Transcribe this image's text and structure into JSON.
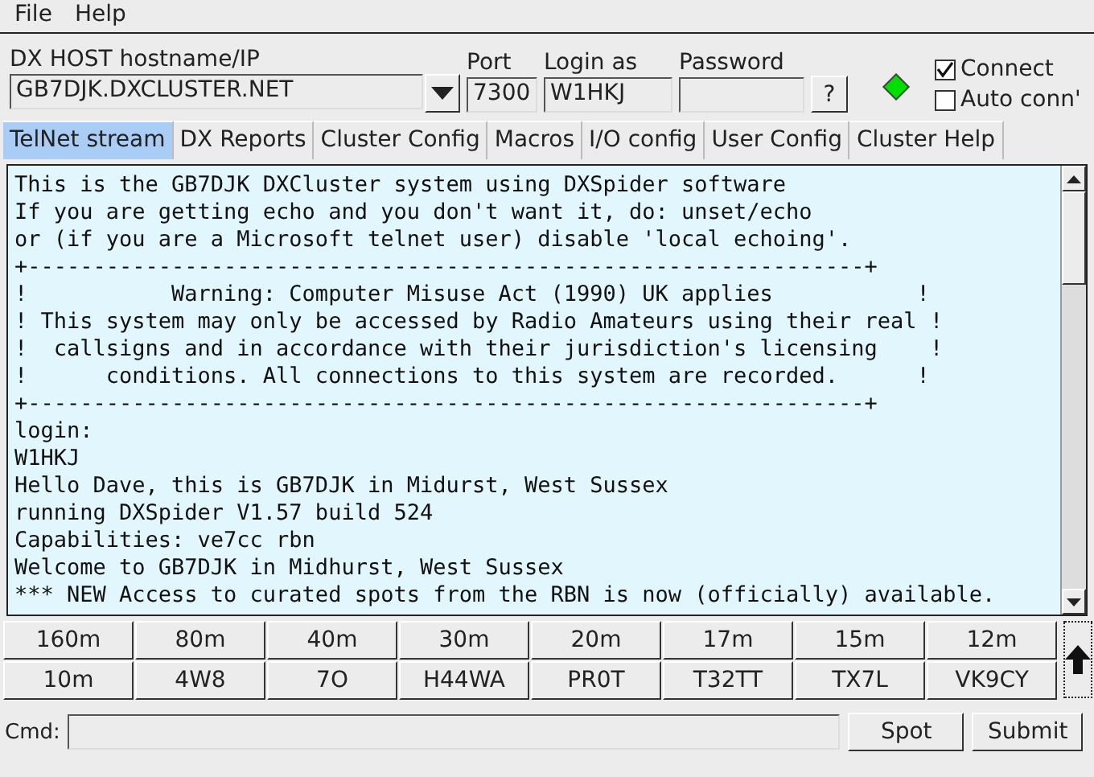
{
  "menu": [
    {
      "label": "File"
    },
    {
      "label": "Help"
    }
  ],
  "connection": {
    "host_label": "DX HOST hostname/IP",
    "host": "GB7DJK.DXCLUSTER.NET",
    "port_label": "Port",
    "port": "7300",
    "login_label": "Login as",
    "login": "W1HKJ",
    "password_label": "Password",
    "help_button": "?",
    "status_connected": true,
    "options": [
      {
        "label": "Connect",
        "checked": true
      },
      {
        "label": "Auto conn'",
        "checked": false
      }
    ]
  },
  "tabs": [
    {
      "label": "TelNet stream",
      "selected": true
    },
    {
      "label": "DX Reports",
      "selected": false
    },
    {
      "label": "Cluster Config",
      "selected": false
    },
    {
      "label": "Macros",
      "selected": false
    },
    {
      "label": "I/O config",
      "selected": false
    },
    {
      "label": "User Config",
      "selected": false
    },
    {
      "label": "Cluster Help",
      "selected": false
    }
  ],
  "stream_lines": [
    "This is the GB7DJK DXCluster system using DXSpider software",
    "If you are getting echo and you don't want it, do: unset/echo",
    "or (if you are a Microsoft telnet user) disable 'local echoing'.",
    "+----------------------------------------------------------------+",
    "!           Warning: Computer Misuse Act (1990) UK applies           !",
    "! This system may only be accessed by Radio Amateurs using their real !",
    "!  callsigns and in accordance with their jurisdiction's licensing    !",
    "!      conditions. All connections to this system are recorded.      !",
    "+----------------------------------------------------------------+",
    "login:",
    "W1HKJ",
    "Hello Dave, this is GB7DJK in Midurst, West Sussex",
    "running DXSpider V1.57 build 524",
    "Capabilities: ve7cc rbn",
    "Welcome to GB7DJK in Midhurst, West Sussex",
    "*** NEW Access to curated spots from the RBN is now (officially) available."
  ],
  "band_buttons": [
    [
      "160m",
      "80m",
      "40m",
      "30m",
      "20m",
      "17m",
      "15m",
      "12m"
    ],
    [
      "10m",
      "4W8",
      "7O",
      "H44WA",
      "PR0T",
      "T32TT",
      "TX7L",
      "VK9CY"
    ]
  ],
  "command": {
    "label": "Cmd:",
    "buttons": [
      "Spot",
      "Submit"
    ]
  }
}
